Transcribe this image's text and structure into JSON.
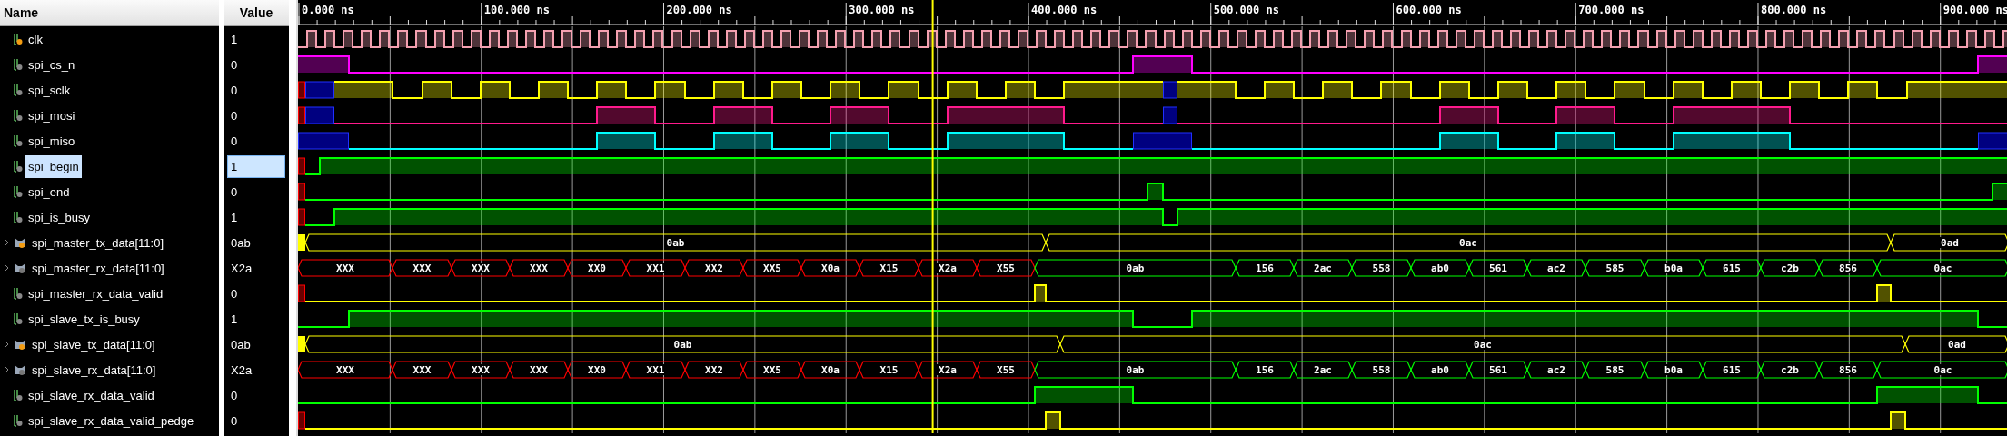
{
  "columns": {
    "name": "Name",
    "value": "Value"
  },
  "timeline": {
    "labels": [
      "0.000 ns",
      "100.000 ns",
      "200.000 ns",
      "300.000 ns",
      "400.000 ns",
      "500.000 ns",
      "600.000 ns",
      "700.000 ns",
      "800.000 ns",
      "900.000 ns"
    ]
  },
  "signals": [
    {
      "name": "clk",
      "value": "1",
      "kind": "bit",
      "selected": false,
      "badge": true,
      "color": "#f4a0b0"
    },
    {
      "name": "spi_cs_n",
      "value": "0",
      "kind": "bit",
      "selected": false,
      "badge": false,
      "color": "#ff00ff"
    },
    {
      "name": "spi_sclk",
      "value": "0",
      "kind": "bit",
      "selected": false,
      "badge": false,
      "color": "#ffff00"
    },
    {
      "name": "spi_mosi",
      "value": "0",
      "kind": "bit",
      "selected": false,
      "badge": false,
      "color": "#ff1a8c"
    },
    {
      "name": "spi_miso",
      "value": "0",
      "kind": "bit",
      "selected": false,
      "badge": false,
      "color": "#00ffff"
    },
    {
      "name": "spi_begin",
      "value": "1",
      "kind": "bit",
      "selected": true,
      "badge": false,
      "color": "#00ff00"
    },
    {
      "name": "spi_end",
      "value": "0",
      "kind": "bit",
      "selected": false,
      "badge": false,
      "color": "#00ff00"
    },
    {
      "name": "spi_is_busy",
      "value": "1",
      "kind": "bit",
      "selected": false,
      "badge": false,
      "color": "#00ff00"
    },
    {
      "name": "spi_master_tx_data[11:0]",
      "value": "0ab",
      "kind": "bus",
      "selected": false,
      "badge": true,
      "color": "#ffff00",
      "segments": [
        "0ab",
        "0ac",
        "0ad"
      ]
    },
    {
      "name": "spi_master_rx_data[11:0]",
      "value": "X2a",
      "kind": "bus",
      "selected": false,
      "badge": false,
      "color": "#00ff00",
      "segments": [
        "XXX",
        "XXX",
        "XXX",
        "XXX",
        "XX0",
        "XX1",
        "XX2",
        "XX5",
        "X0a",
        "X15",
        "X2a",
        "X55",
        "0ab",
        "156",
        "2ac",
        "558",
        "ab0",
        "561",
        "ac2",
        "585",
        "b0a",
        "615",
        "c2b",
        "856",
        "0ac"
      ]
    },
    {
      "name": "spi_master_rx_data_valid",
      "value": "0",
      "kind": "bit",
      "selected": false,
      "badge": false,
      "color": "#ffff00"
    },
    {
      "name": "spi_slave_tx_is_busy",
      "value": "1",
      "kind": "bit",
      "selected": false,
      "badge": false,
      "color": "#00ff00"
    },
    {
      "name": "spi_slave_tx_data[11:0]",
      "value": "0ab",
      "kind": "bus",
      "selected": false,
      "badge": true,
      "color": "#ffff00",
      "segments": [
        "0ab",
        "0ac",
        "0ad"
      ]
    },
    {
      "name": "spi_slave_rx_data[11:0]",
      "value": "X2a",
      "kind": "bus",
      "selected": false,
      "badge": false,
      "color": "#00ff00",
      "segments": [
        "XXX",
        "XXX",
        "XXX",
        "XXX",
        "XX0",
        "XX1",
        "XX2",
        "XX5",
        "X0a",
        "X15",
        "X2a",
        "X55",
        "0ab",
        "156",
        "2ac",
        "558",
        "ab0",
        "561",
        "ac2",
        "585",
        "b0a",
        "615",
        "c2b",
        "856",
        "0ac"
      ]
    },
    {
      "name": "spi_slave_rx_data_valid",
      "value": "0",
      "kind": "bit",
      "selected": false,
      "badge": false,
      "color": "#00ff00"
    },
    {
      "name": "spi_slave_rx_data_valid_pedge",
      "value": "0",
      "kind": "bit",
      "selected": false,
      "badge": false,
      "color": "#ffff00"
    }
  ]
}
